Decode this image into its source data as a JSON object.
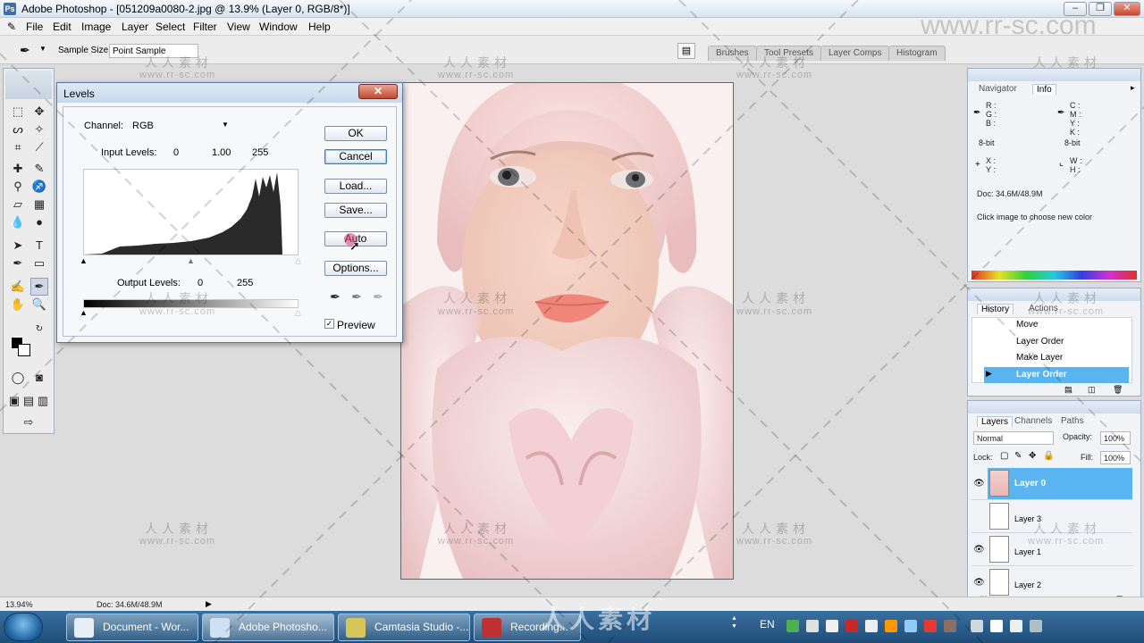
{
  "window": {
    "title": "Adobe Photoshop - [051209a0080-2.jpg @ 13.9% (Layer 0, RGB/8*)]",
    "min": "–",
    "max": "❐",
    "close": "✕"
  },
  "menu": [
    "File",
    "Edit",
    "Image",
    "Layer",
    "Select",
    "Filter",
    "View",
    "Window",
    "Help"
  ],
  "options_bar": {
    "sample_size_label": "Sample Size:",
    "sample_size_value": "Point Sample"
  },
  "palette_well": [
    "Brushes",
    "Tool Presets",
    "Layer Comps",
    "Histogram"
  ],
  "levels": {
    "title": "Levels",
    "close": "✕",
    "channel_label": "Channel:",
    "channel_value": "RGB",
    "input_label": "Input Levels:",
    "input_black": "0",
    "input_gamma": "1.00",
    "input_white": "255",
    "output_label": "Output Levels:",
    "output_black": "0",
    "output_white": "255",
    "buttons": {
      "ok": "OK",
      "cancel": "Cancel",
      "load": "Load...",
      "save": "Save...",
      "auto": "Auto",
      "options": "Options..."
    },
    "preview_label": "Preview",
    "preview_checked": "✓"
  },
  "info_panel": {
    "tabs": [
      "Navigator",
      "Info"
    ],
    "r": "R :",
    "g": "G :",
    "b": "B :",
    "c": "C :",
    "m": "M :",
    "y": "Y :",
    "k": "K :",
    "bit_left": "8-bit",
    "bit_right": "8-bit",
    "x": "X :",
    "yy": "Y :",
    "w": "W :",
    "h": "H :",
    "doc": "Doc: 34.6M/48.9M",
    "hint": "Click image to choose new color"
  },
  "history_panel": {
    "tabs": [
      "History",
      "Actions"
    ],
    "items": [
      "Move",
      "Layer Order",
      "Make Layer",
      "Layer Order"
    ]
  },
  "layers_panel": {
    "tabs": [
      "Layers",
      "Channels",
      "Paths"
    ],
    "blend_mode": "Normal",
    "opacity_label": "Opacity:",
    "opacity_value": "100%",
    "lock_label": "Lock:",
    "fill_label": "Fill:",
    "fill_value": "100%",
    "layers": [
      "Layer 0",
      "Layer 3",
      "Layer 1",
      "Layer 2"
    ]
  },
  "status_bar": {
    "zoom": "13.94%",
    "doc": "Doc: 34.6M/48.9M"
  },
  "taskbar": {
    "tasks": [
      "Document - Wor...",
      "Adobe Photosho...",
      "Camtasia Studio -...",
      "Recording..."
    ],
    "lang": "EN"
  },
  "watermark": {
    "cn": "人人素材",
    "url": "www.rr-sc.com",
    "url_big": "www.rr-sc.com"
  },
  "colors": {
    "selection": "#5ab4f0",
    "accent": "#3f7bc6"
  }
}
